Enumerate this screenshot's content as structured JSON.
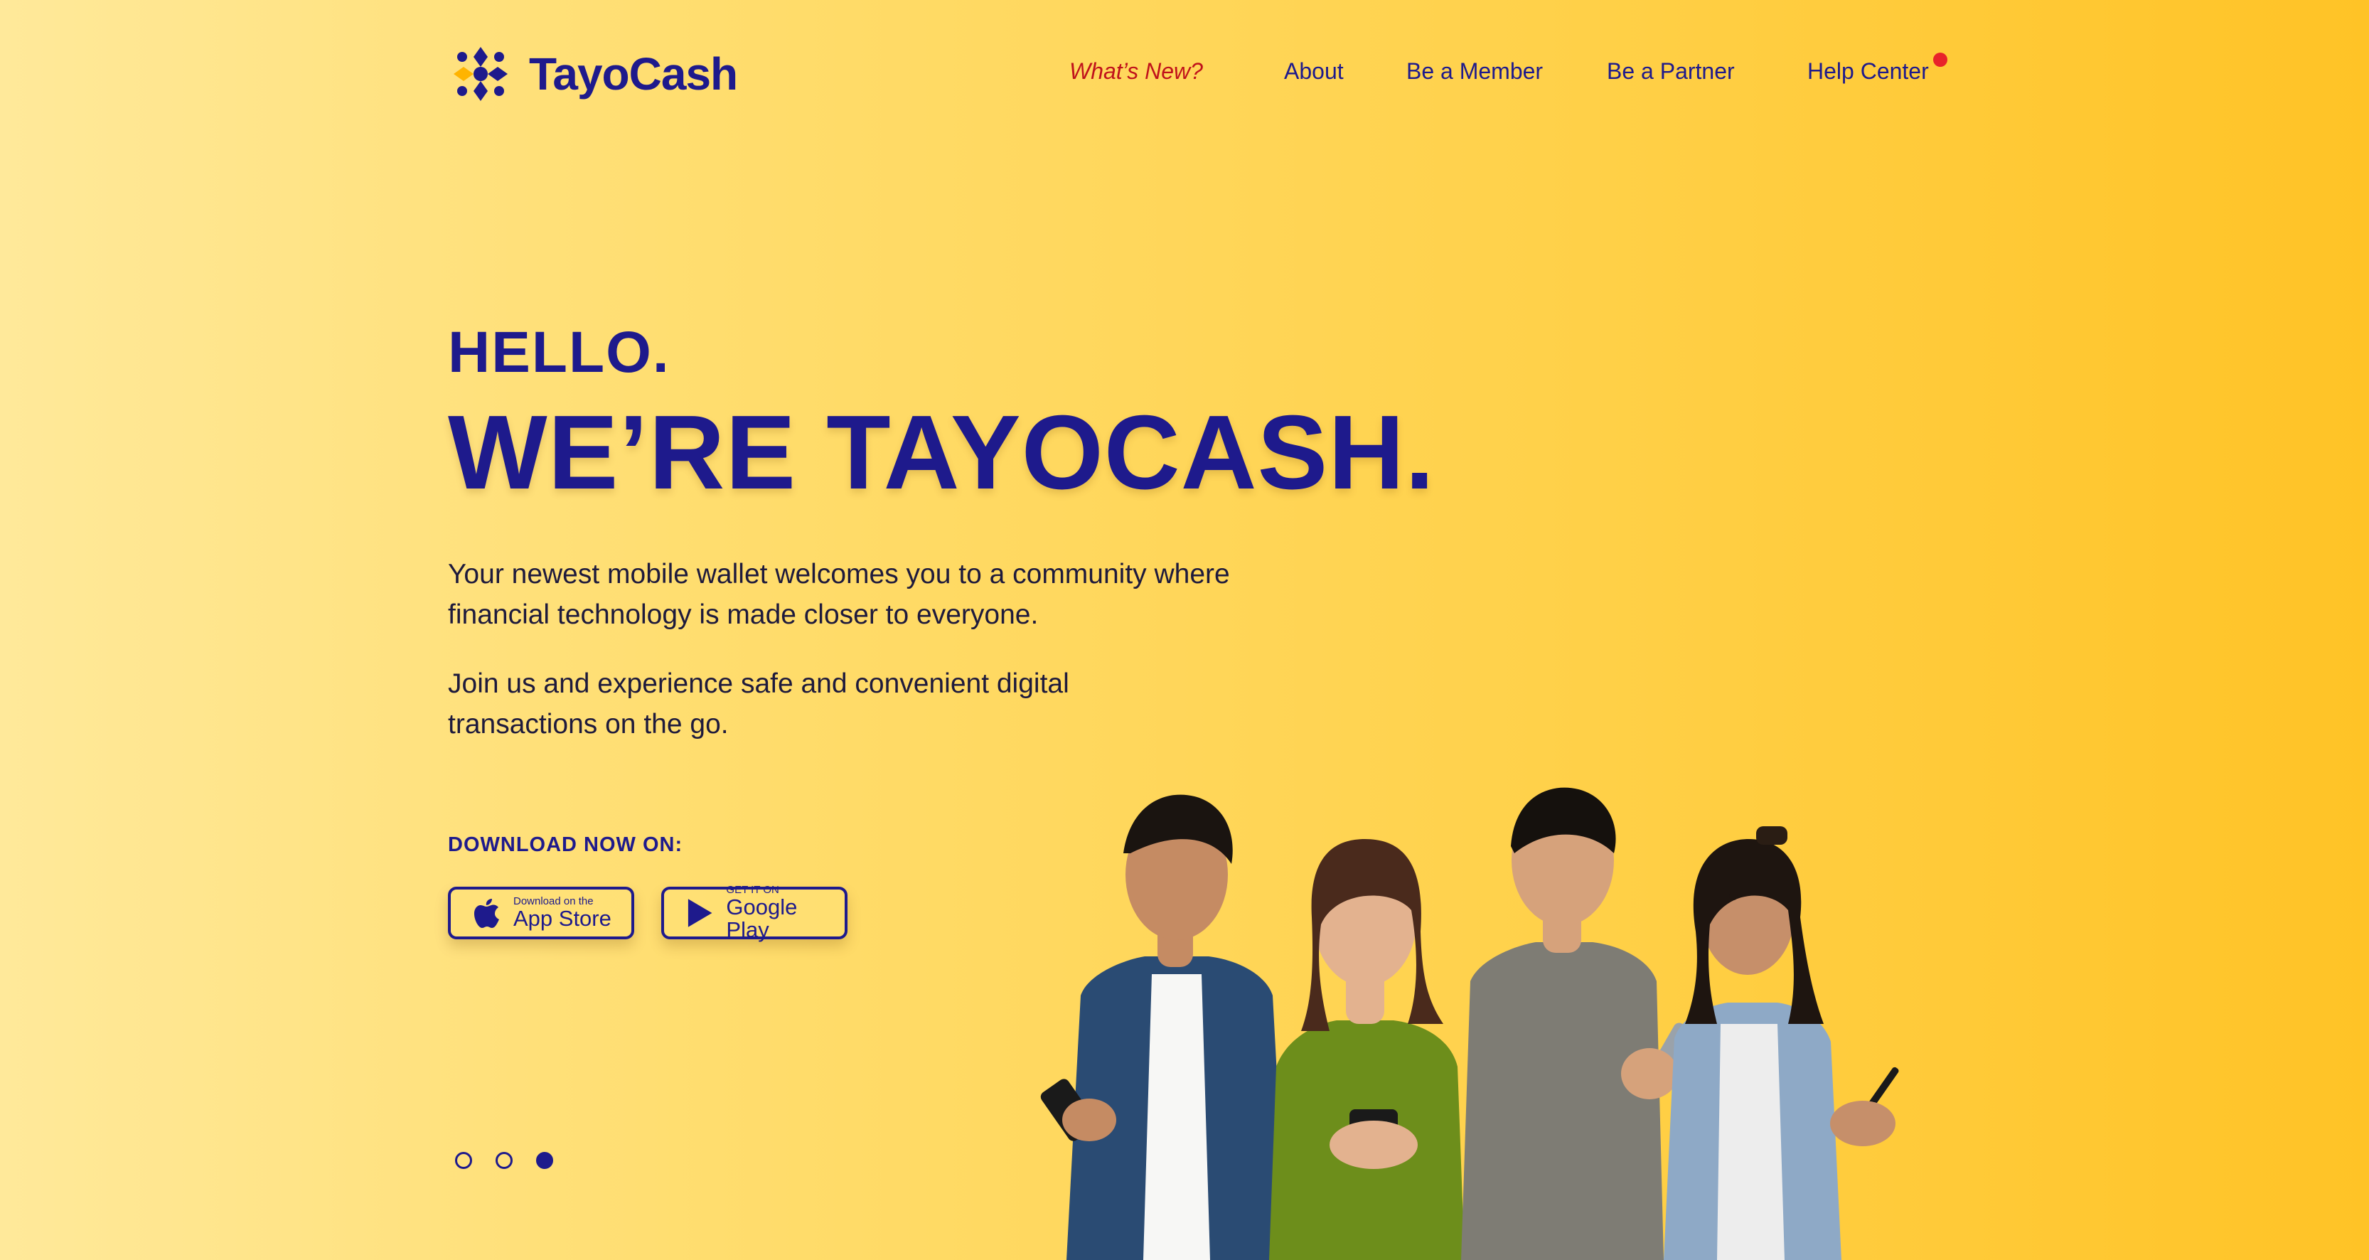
{
  "brand": {
    "name": "TayoCash",
    "logo_icon": "tayocash-logo-icon",
    "colors": {
      "primary": "#1E1A8C",
      "accent": "#FFC326",
      "alert": "#E8232A",
      "highlight": "#C0121B"
    }
  },
  "nav": {
    "items": [
      {
        "label": "What’s New?"
      },
      {
        "label": "About"
      },
      {
        "label": "Be a Member"
      },
      {
        "label": "Be a Partner"
      },
      {
        "label": "Help Center"
      }
    ]
  },
  "hero": {
    "greeting": "HELLO.",
    "headline": "WE’RE TAYOCASH.",
    "paragraph1": "Your newest mobile wallet welcomes you to a community where financial technology is made closer to everyone.",
    "paragraph2": "Join us and experience safe and convenient digital transactions on the go."
  },
  "download": {
    "label": "DOWNLOAD NOW ON:",
    "app_store": {
      "small": "Download on the",
      "big": "App Store",
      "icon": "apple-icon"
    },
    "google_play": {
      "small": "GET IT ON",
      "big": "Google Play",
      "icon": "play-icon"
    }
  },
  "carousel": {
    "slides": 3,
    "active": 3
  },
  "image": {
    "subject": "four smiling people holding smartphones",
    "icon": "people-photo"
  }
}
